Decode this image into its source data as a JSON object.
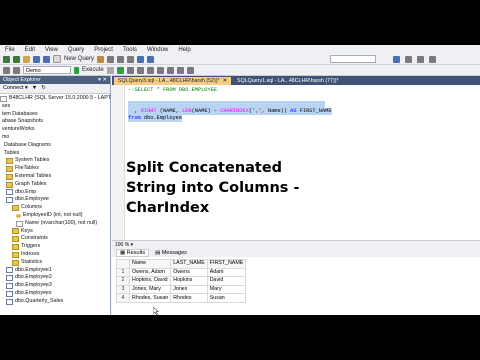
{
  "menu": [
    "File",
    "Edit",
    "View",
    "Query",
    "Project",
    "Tools",
    "Window",
    "Help"
  ],
  "toolbar": {
    "new_query": "New Query",
    "execute": "Execute",
    "database": "Demo"
  },
  "object_explorer": {
    "title": "Object Explorer",
    "connect": "Connect ▾",
    "items": [
      {
        "label": "B48CLHR (SQL Server 15.0.2000.5 - LAPTOP",
        "icon": "server-icon",
        "type": "plain"
      },
      {
        "label": "ses",
        "icon": "",
        "type": "plain"
      },
      {
        "label": "tem Databases",
        "icon": "",
        "type": "plain"
      },
      {
        "label": "abase Snapshots",
        "icon": "",
        "type": "plain"
      },
      {
        "label": "ventureWorks",
        "icon": "",
        "type": "plain"
      },
      {
        "label": "mo",
        "icon": "",
        "type": "plain"
      },
      {
        "label": "Database Diagrams",
        "icon": "",
        "type": "plain"
      },
      {
        "label": "Tables",
        "icon": "",
        "type": "plain"
      },
      {
        "label": "System Tables",
        "icon": "folder-icon",
        "type": "folder"
      },
      {
        "label": "FileTables",
        "icon": "folder-icon",
        "type": "folder"
      },
      {
        "label": "External Tables",
        "icon": "folder-icon",
        "type": "folder"
      },
      {
        "label": "Graph Tables",
        "icon": "folder-icon",
        "type": "folder"
      },
      {
        "label": "dbo.Emp",
        "icon": "table-icon",
        "type": "table"
      },
      {
        "label": "dbo.Employee",
        "icon": "table-icon",
        "type": "table"
      },
      {
        "label": "Columns",
        "icon": "folder-icon",
        "type": "folder"
      },
      {
        "label": "EmployeeID (int, not null)",
        "icon": "key-icon",
        "type": "key"
      },
      {
        "label": "Name (nvarchar(100), not null)",
        "icon": "column-icon",
        "type": "column"
      },
      {
        "label": "Keys",
        "icon": "folder-icon",
        "type": "folder"
      },
      {
        "label": "Constraints",
        "icon": "folder-icon",
        "type": "folder"
      },
      {
        "label": "Triggers",
        "icon": "folder-icon",
        "type": "folder"
      },
      {
        "label": "Indexes",
        "icon": "folder-icon",
        "type": "folder"
      },
      {
        "label": "Statistics",
        "icon": "folder-icon",
        "type": "folder"
      },
      {
        "label": "dbo.Employee1",
        "icon": "table-icon",
        "type": "table"
      },
      {
        "label": "dbo.Employee2",
        "icon": "table-icon",
        "type": "table"
      },
      {
        "label": "dbo.Employee3",
        "icon": "table-icon",
        "type": "table"
      },
      {
        "label": "dbo.Employees",
        "icon": "table-icon",
        "type": "table"
      },
      {
        "label": "dbo.Quarterly_Sales",
        "icon": "table-icon",
        "type": "table"
      }
    ]
  },
  "editor": {
    "tabs": [
      {
        "label": "SQLQuery3.sql - LA...48CLHR\\harsh (52))*",
        "active": true
      },
      {
        "label": "SQLQuery1.sql - LA...48CLHR\\harsh (77))*",
        "active": false
      }
    ],
    "line1": "--SELECT * FROM DBO.EMPLOYEE",
    "line3a": "SELECT Name ,LEFT (NAME, CHARINDEX(',', Name) -1) AS LAST_NAME",
    "line4a": "  , RIGHT (NAME, LEN(NAME) - CHARINDEX(',', Name)) AS FIRST_NAME",
    "line5a": "from dbo.Employee",
    "overlay_title": "Split Concatenated String into Columns - CharIndex",
    "zoom": "100 % ▾"
  },
  "results": {
    "tab_results": "Results",
    "tab_messages": "Messages",
    "columns": [
      "Name",
      "LAST_NAME",
      "FIRST_NAME"
    ],
    "rows": [
      {
        "num": "1",
        "cells": [
          "Owens, Adam",
          "Owens",
          "Adam"
        ]
      },
      {
        "num": "2",
        "cells": [
          "Hopkins, David",
          "Hopkins",
          "David"
        ]
      },
      {
        "num": "3",
        "cells": [
          "Jones, Mary",
          "Jones",
          "Mary"
        ]
      },
      {
        "num": "4",
        "cells": [
          "Rhodes, Susan",
          "Rhodes",
          "Susan"
        ]
      }
    ]
  },
  "colors": {
    "accent": "#3f5375",
    "tab_active": "#f5cc84",
    "selection": "#b9d3f3"
  }
}
